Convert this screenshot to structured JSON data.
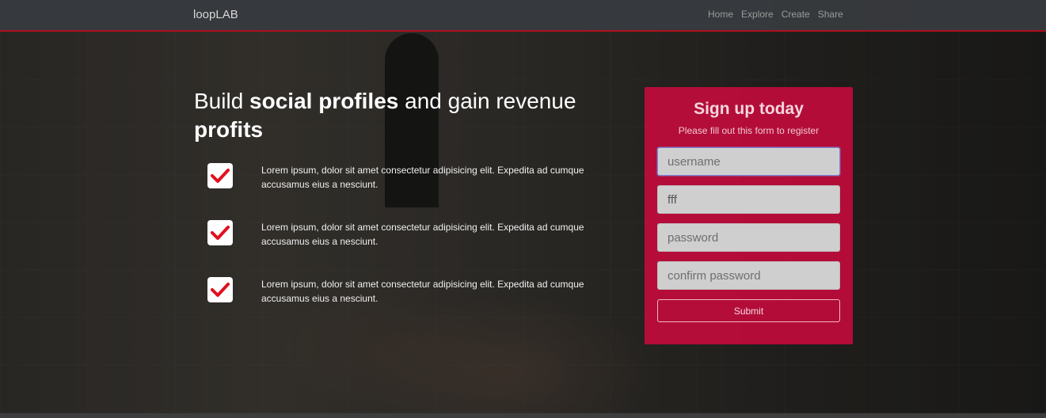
{
  "navbar": {
    "brand": "loopLAB",
    "links": [
      "Home",
      "Explore",
      "Create",
      "Share"
    ]
  },
  "hero": {
    "headline_part1": "Build ",
    "headline_bold1": "social profiles",
    "headline_part2": " and gain revenue ",
    "headline_bold2": "profits",
    "features": [
      {
        "icon": "check-icon",
        "text": "Lorem ipsum, dolor sit amet consectetur adipisicing elit. Expedita ad cumque accusamus eius a nesciunt."
      },
      {
        "icon": "check-icon",
        "text": "Lorem ipsum, dolor sit amet consectetur adipisicing elit. Expedita ad cumque accusamus eius a nesciunt."
      },
      {
        "icon": "check-icon",
        "text": "Lorem ipsum, dolor sit amet consectetur adipisicing elit. Expedita ad cumque accusamus eius a nesciunt."
      }
    ]
  },
  "signup": {
    "title": "Sign up today",
    "subtitle": "Please fill out this form to register",
    "username_placeholder": "username",
    "email_value": "fff",
    "password_placeholder": "password",
    "confirm_placeholder": "confirm password",
    "submit_label": "Submit"
  },
  "colors": {
    "accent": "#c80a3e",
    "nav_border": "#b0101f",
    "check": "#e0101f"
  }
}
